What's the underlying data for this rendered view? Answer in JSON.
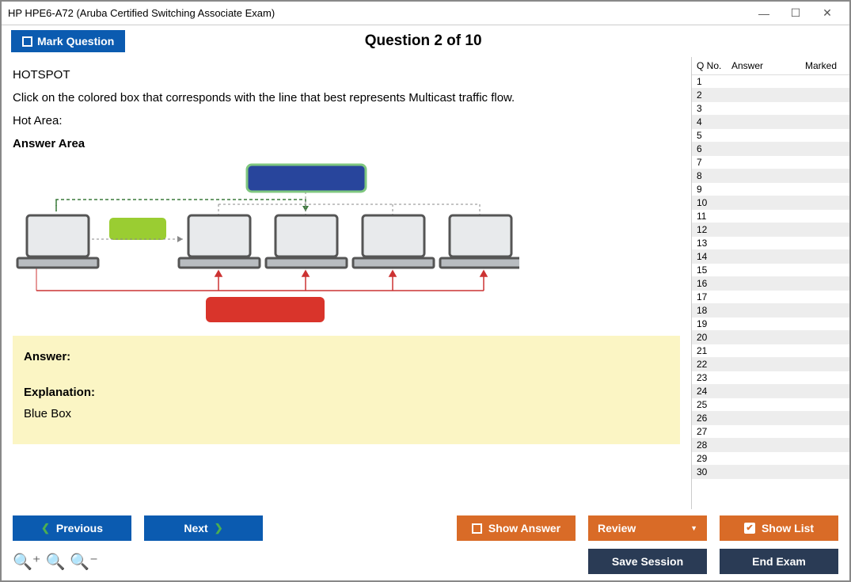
{
  "window": {
    "title": "HP HPE6-A72 (Aruba Certified Switching Associate Exam)"
  },
  "header": {
    "mark_label": "Mark Question",
    "question_title": "Question 2 of 10"
  },
  "question": {
    "type_label": "HOTSPOT",
    "prompt": "Click on the colored box that corresponds with the line that best represents Multicast traffic flow.",
    "hot_area_label": "Hot Area:",
    "answer_area_label": "Answer Area"
  },
  "answer_panel": {
    "answer_label": "Answer:",
    "explanation_label": "Explanation:",
    "explanation_text": "Blue Box"
  },
  "side": {
    "col_qno": "Q No.",
    "col_answer": "Answer",
    "col_marked": "Marked",
    "rows": 30
  },
  "buttons": {
    "previous": "Previous",
    "next": "Next",
    "show_answer": "Show Answer",
    "review": "Review",
    "show_list": "Show List",
    "save_session": "Save Session",
    "end_exam": "End Exam"
  }
}
